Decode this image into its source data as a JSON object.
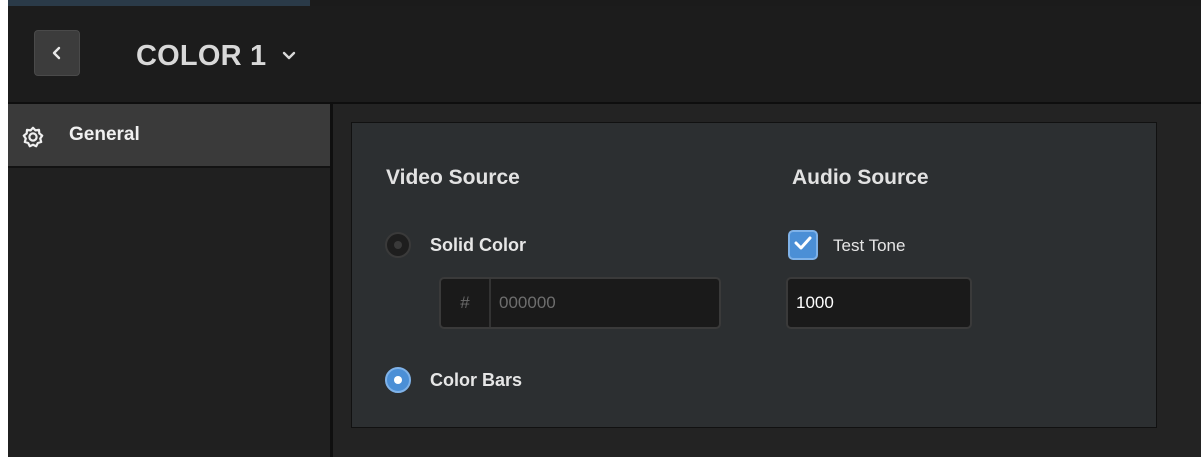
{
  "header": {
    "title": "COLOR 1",
    "back_icon": "chevron-left-icon",
    "dropdown_icon": "chevron-down-icon"
  },
  "sidebar": {
    "items": [
      {
        "label": "General",
        "icon": "gear-icon",
        "active": true
      }
    ]
  },
  "video_source": {
    "heading": "Video Source",
    "options": [
      {
        "label": "Solid Color",
        "selected": false
      },
      {
        "label": "Color Bars",
        "selected": true
      }
    ],
    "color_prefix": "#",
    "color_value": "",
    "color_placeholder": "000000"
  },
  "audio_source": {
    "heading": "Audio Source",
    "test_tone_label": "Test Tone",
    "test_tone_checked": true,
    "tone_value": "1000"
  },
  "colors": {
    "accent": "#4b8fd6",
    "panel": "#2c2f31",
    "sidebar_active": "#3a3a3a"
  }
}
